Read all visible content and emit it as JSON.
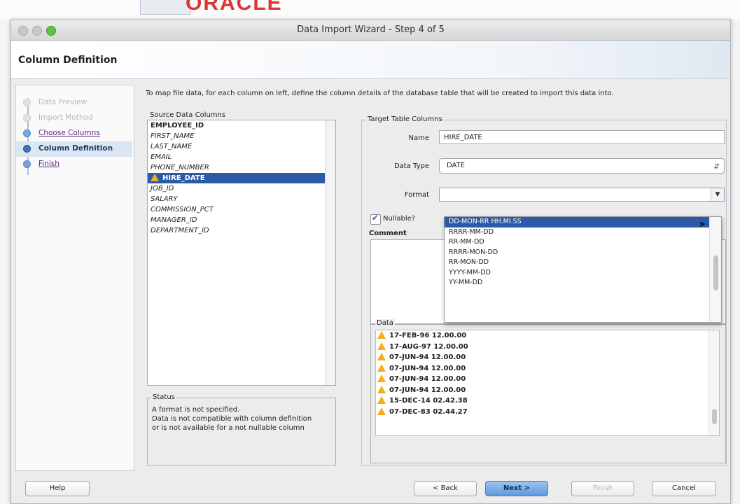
{
  "background": {
    "brand_text": "ORACLE"
  },
  "window": {
    "title": "Data Import Wizard - Step 4 of 5"
  },
  "header": {
    "title": "Column Definition"
  },
  "nav": {
    "items": [
      {
        "label": "Data Preview",
        "state": "disabled"
      },
      {
        "label": "Import Method",
        "state": "disabled"
      },
      {
        "label": "Choose Columns",
        "state": "link"
      },
      {
        "label": "Column Definition",
        "state": "active"
      },
      {
        "label": "Finish",
        "state": "link"
      }
    ]
  },
  "main": {
    "instruction": "To map file data, for each column on left, define the column details of the database table that will be created to import this data into.",
    "source": {
      "label": "Source Data Columns",
      "items": [
        "EMPLOYEE_ID",
        "FIRST_NAME",
        "LAST_NAME",
        "EMAIL",
        "PHONE_NUMBER",
        "HIRE_DATE",
        "JOB_ID",
        "SALARY",
        "COMMISSION_PCT",
        "MANAGER_ID",
        "DEPARTMENT_ID"
      ],
      "selected": "HIRE_DATE"
    },
    "status": {
      "label": "Status",
      "lines": [
        "A format is not specified.",
        "Data is not compatible with column definition",
        "or is not available for a not nullable column"
      ]
    },
    "target": {
      "label": "Target Table Columns",
      "name_label": "Name",
      "name_value": "HIRE_DATE",
      "datatype_label": "Data Type",
      "datatype_value": "DATE",
      "format_label": "Format",
      "format_value": "",
      "nullable_label": "Nullable?",
      "nullable_checked": true,
      "comment_label": "Comment"
    },
    "format_options": [
      "DD-MON-RR HH.MI.SS",
      "RRRR-MM-DD",
      "RR-MM-DD",
      "RRRR-MON-DD",
      "RR-MON-DD",
      "YYYY-MM-DD",
      "YY-MM-DD"
    ],
    "data": {
      "label": "Data",
      "rows": [
        "17-FEB-96 12.00.00",
        "17-AUG-97 12.00.00",
        "07-JUN-94 12.00.00",
        "07-JUN-94 12.00.00",
        "07-JUN-94 12.00.00",
        "07-JUN-94 12.00.00",
        "15-DEC-14 02.42.38",
        "07-DEC-83 02.44.27"
      ]
    }
  },
  "footer": {
    "help": "Help",
    "back": "< Back",
    "next": "Next >",
    "finish": "Finish",
    "cancel": "Cancel"
  },
  "colors": {
    "selection": "#2d5aa8",
    "warning": "#f3b01c",
    "primary_button": "#5d99dd",
    "link": "#5b2a86"
  },
  "icons": {
    "warning": "warning-triangle-icon",
    "step": "step-dot-icon",
    "checkbox": "checkmark-icon",
    "dropdown": "chevron-down-icon"
  }
}
